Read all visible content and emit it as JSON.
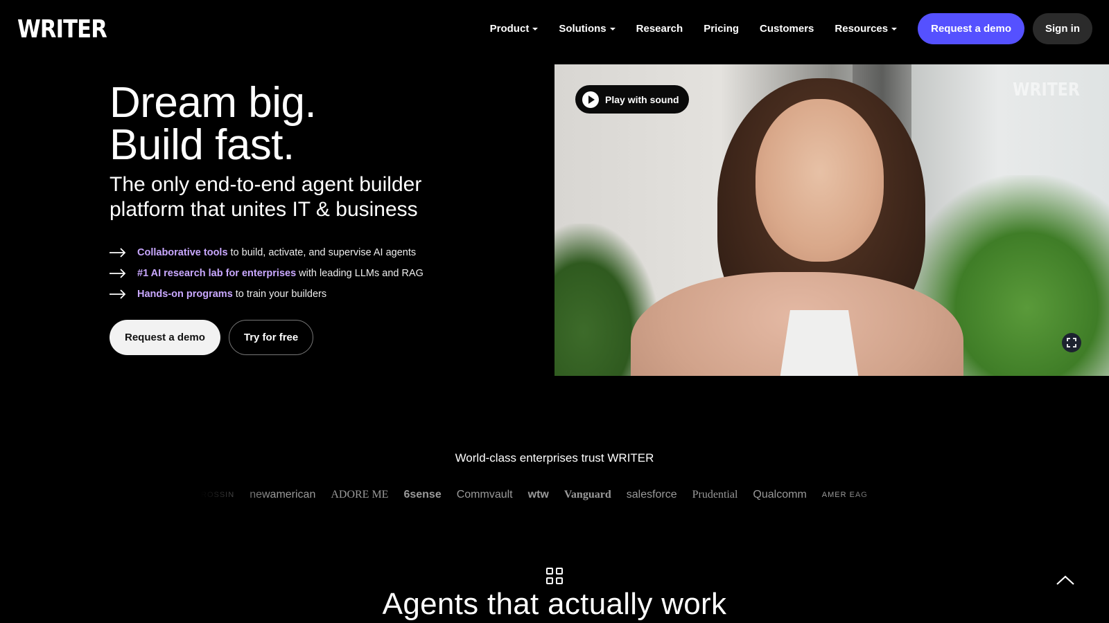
{
  "brand": {
    "logo": "WRITER"
  },
  "nav": {
    "items": [
      {
        "label": "Product",
        "dropdown": true
      },
      {
        "label": "Solutions",
        "dropdown": true
      },
      {
        "label": "Research",
        "dropdown": false
      },
      {
        "label": "Pricing",
        "dropdown": false
      },
      {
        "label": "Customers",
        "dropdown": false
      },
      {
        "label": "Resources",
        "dropdown": true
      }
    ],
    "demo_label": "Request a demo",
    "signin_label": "Sign in"
  },
  "hero": {
    "title_line1": "Dream big.",
    "title_line2": "Build fast.",
    "subtitle": "The only end-to-end agent builder platform that unites IT & business",
    "features": [
      {
        "highlight": "Collaborative tools",
        "rest": "to build, activate, and supervise AI agents"
      },
      {
        "highlight": "#1 AI research lab for enterprises",
        "rest": "with leading LLMs and RAG"
      },
      {
        "highlight": "Hands-on programs",
        "rest": "to train your builders"
      }
    ],
    "cta_primary": "Request a demo",
    "cta_secondary": "Try for free"
  },
  "video": {
    "play_label": "Play with sound",
    "watermark": "WRITER"
  },
  "trust": {
    "title": "World-class enterprises trust WRITER",
    "logos": [
      "ROSSIN",
      "newamerican",
      "ADORE ME",
      "6sense",
      "Commvault",
      "wtw",
      "Vanguard",
      "salesforce",
      "Prudential",
      "Qualcomm",
      "AMER EAG"
    ]
  },
  "agents": {
    "title": "Agents that actually work"
  },
  "colors": {
    "accent": "#5551ff",
    "highlight": "#c9a8ff",
    "background": "#000000"
  }
}
